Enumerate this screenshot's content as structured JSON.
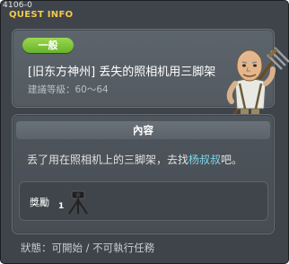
{
  "window": {
    "quest_id": "4106-0",
    "title": "QUEST INFO"
  },
  "quest": {
    "type_badge": "一般",
    "name": "[旧东方神州] 丢失的照相机用三脚架",
    "level_label": "建議等級：60～64",
    "npc_icon": "old-man-with-pitchfork"
  },
  "content": {
    "header": "內容",
    "body_prefix": "丢了用在照相机上的三脚架，去找",
    "body_npc": "杨叔叔",
    "body_suffix": "吧。"
  },
  "reward": {
    "label": "獎勵",
    "item_icon": "tripod-icon",
    "item_count": "1"
  },
  "status": {
    "text": "狀態：可開始 / 不可執行任務"
  },
  "colors": {
    "title": "#f3c94b",
    "badge": "#7cc33a",
    "npc_name": "#7fd5e8",
    "window_bg": "#3e444a"
  }
}
